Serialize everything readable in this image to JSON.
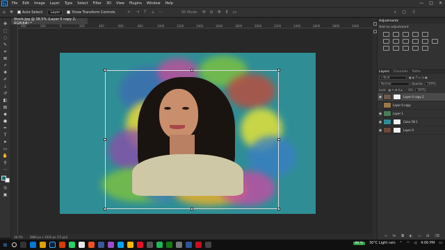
{
  "menubar": {
    "logo": "Ps",
    "items": [
      "File",
      "Edit",
      "Image",
      "Layer",
      "Type",
      "Select",
      "Filter",
      "3D",
      "View",
      "Plugins",
      "Window",
      "Help"
    ],
    "window_controls": [
      "—",
      "□",
      "✕"
    ]
  },
  "options": {
    "auto_select_label": "Auto-Select:",
    "auto_select_target": "Layer",
    "show_transform_label": "Show Transform Controls",
    "mode_3d_label": "3D Mode:"
  },
  "document": {
    "tab_title": "Stock.jpg @ 38.5% (Layer 0 copy 2, RGB/8#) *",
    "zoom": "38.5%",
    "doc_info": "2880 px x 1620 px (72 ppi)"
  },
  "ruler": {
    "ticks": [
      "400",
      "200",
      "0",
      "200",
      "400",
      "600",
      "800",
      "1000",
      "1200",
      "1400",
      "1600",
      "1800",
      "2000",
      "2200",
      "2400",
      "2600",
      "2800",
      "3000"
    ]
  },
  "adjustments": {
    "tab": "Adjustments",
    "hint": "Add an adjustment"
  },
  "layers_panel": {
    "tabs": [
      "Layers",
      "Channels",
      "Paths"
    ],
    "kind_filter": "Kind",
    "blend_mode": "Normal",
    "opacity_label": "Opacity:",
    "opacity_value": "100%",
    "lock_label": "Lock:",
    "fill_label": "Fill:",
    "fill_value": "100%",
    "layers": [
      {
        "name": "Layer 0 copy 2",
        "visible": true,
        "selected": true,
        "thumb": "#6d5a50",
        "mask": true
      },
      {
        "name": "Layer 0 copy",
        "visible": false,
        "selected": false,
        "thumb": "#9a7a4a",
        "mask": false
      },
      {
        "name": "Layer 1",
        "visible": true,
        "selected": false,
        "thumb": "#4a7d58",
        "mask": false
      },
      {
        "name": "Color Fill 1",
        "visible": true,
        "selected": false,
        "thumb": "#2f8e95",
        "mask": true
      },
      {
        "name": "Layer 0",
        "visible": true,
        "selected": false,
        "thumb": "#6b4a3a",
        "mask": true
      }
    ],
    "footer_icons": [
      "link-icon",
      "fx-icon",
      "mask-icon",
      "adjustment-icon",
      "folder-icon",
      "new-layer-icon",
      "trash-icon"
    ]
  },
  "taskbar": {
    "battery": "96 %",
    "weather": "30°C  Light rain",
    "time": "4:00 PM"
  },
  "colors": {
    "canvas_bg": "#2f8e95",
    "accent": "#31a8ff"
  }
}
